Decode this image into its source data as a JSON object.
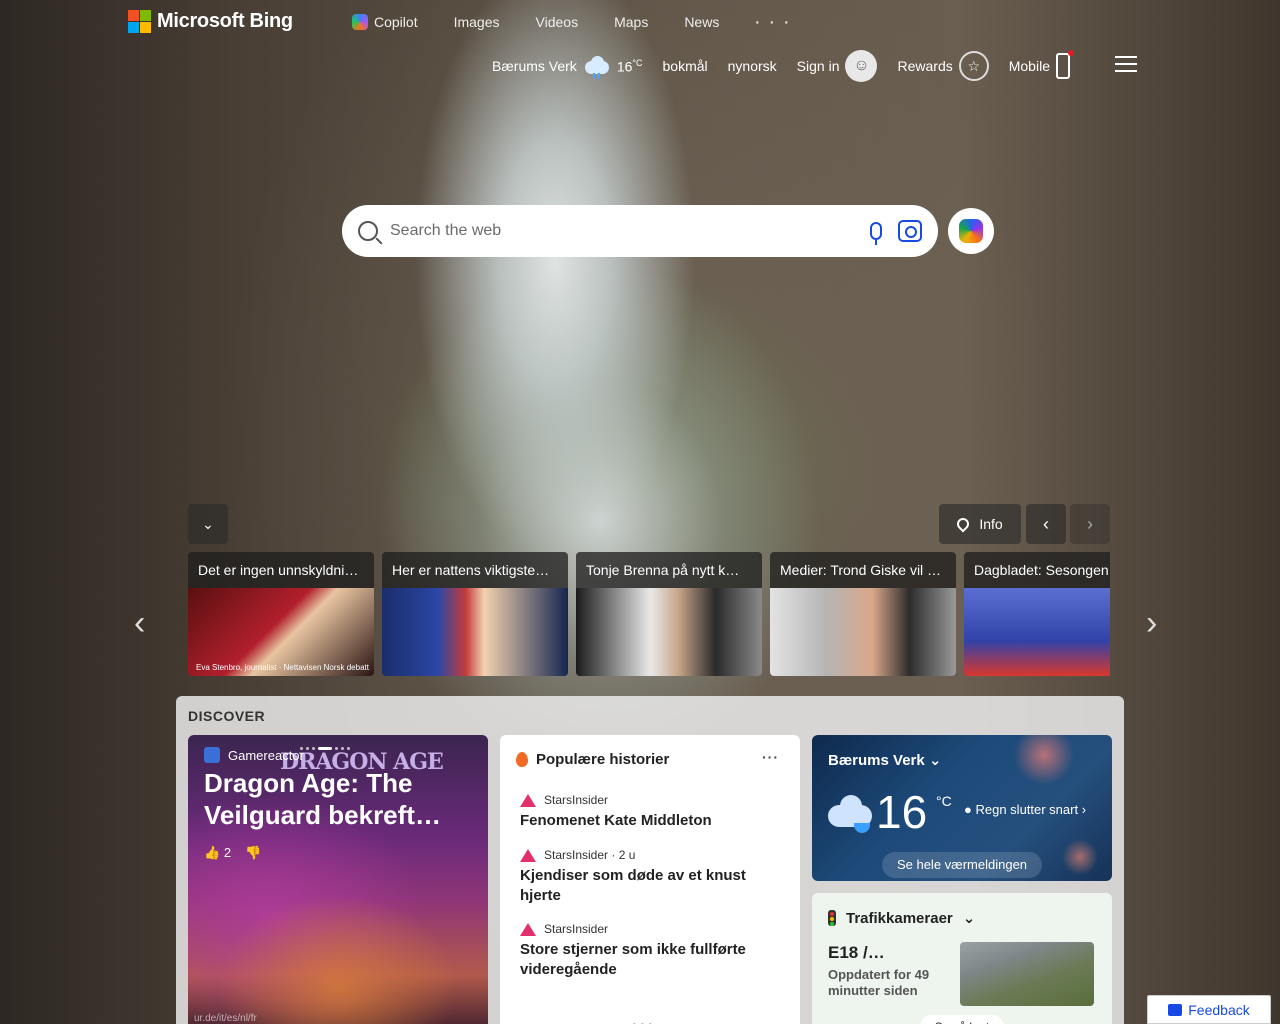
{
  "brand": {
    "logo_text": "Microsoft Bing",
    "colors": [
      "#f25022",
      "#7fba00",
      "#00a4ef",
      "#ffb900"
    ]
  },
  "topnav": {
    "items": [
      {
        "label": "Copilot",
        "icon": "copilot-icon"
      },
      {
        "label": "Images"
      },
      {
        "label": "Videos"
      },
      {
        "label": "Maps"
      },
      {
        "label": "News"
      },
      {
        "label": "· · ·"
      }
    ]
  },
  "subnav": {
    "location": "Bærums Verk",
    "temp": "16",
    "temp_unit": "°C",
    "lang1": "bokmål",
    "lang2": "nynorsk",
    "signin": "Sign in",
    "rewards": "Rewards",
    "mobile": "Mobile"
  },
  "search": {
    "placeholder": "Search the web"
  },
  "image_controls": {
    "info": "Info"
  },
  "news": [
    {
      "title": "Det er ingen unnskyldning…",
      "caption": "Eva Stenbro, journalist · Nettavisen Norsk debatt"
    },
    {
      "title": "Her er nattens viktigste…"
    },
    {
      "title": "Tonje Brenna på nytt k…"
    },
    {
      "title": "Medier: Trond Giske vil …"
    },
    {
      "title": "Dagbladet: Sesongen"
    }
  ],
  "discover": {
    "heading": "DISCOVER",
    "feature": {
      "source": "Gamereactor",
      "brand": "DRAGON AGE",
      "title": "Dragon Age: The Veilguard bekreft…",
      "likes": "2",
      "footer": "ur.de/it/es/nl/fr"
    },
    "popular": {
      "heading": "Populære historier",
      "more": "···",
      "items": [
        {
          "source": "StarsInsider",
          "title": "Fenomenet Kate Middleton"
        },
        {
          "source": "StarsInsider · 2 u",
          "title": "Kjendiser som døde av et knust hjerte"
        },
        {
          "source": "StarsInsider",
          "title": "Store stjerner som ikke fullførte videregående"
        }
      ],
      "footer_dots": "•••"
    },
    "weather": {
      "location": "Bærums Verk",
      "temp": "16",
      "unit": "°C",
      "condition": "Regn slutter snart",
      "link": "Se hele værmeldingen"
    },
    "traffic": {
      "heading": "Trafikkameraer",
      "road": "E18 /…",
      "updated": "Oppdatert for 49 minutter siden",
      "map_link": "Se på kart"
    }
  },
  "feedback": {
    "label": "Feedback"
  }
}
